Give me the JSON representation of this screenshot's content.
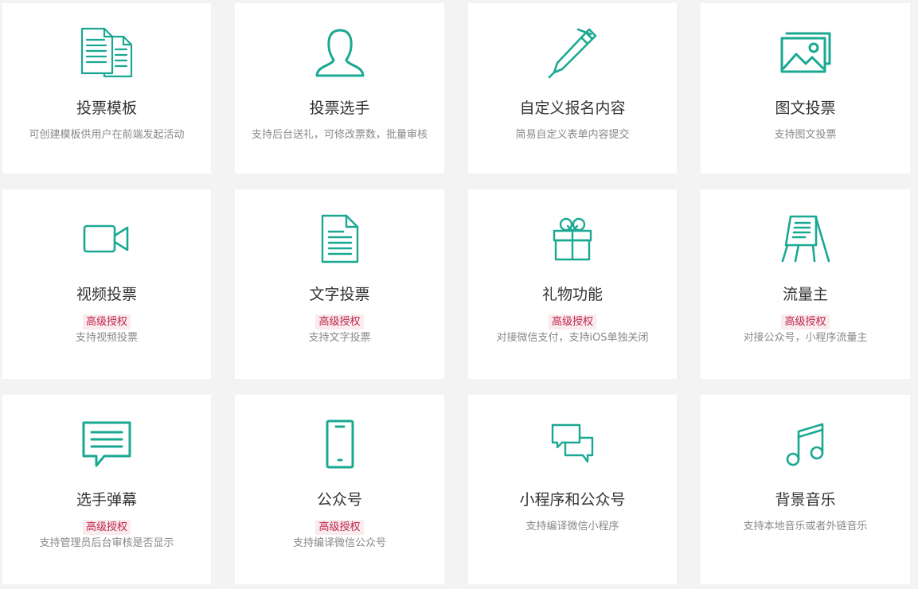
{
  "accent": "#1aa892",
  "badge_color": "#c0264c",
  "cards": [
    {
      "title": "投票模板",
      "badge": "",
      "desc": "可创建模板供用户在前端发起活动",
      "icon": "documents-icon"
    },
    {
      "title": "投票选手",
      "badge": "",
      "desc": "支持后台送礼，可修改票数，批量审核",
      "icon": "person-icon"
    },
    {
      "title": "自定义报名内容",
      "badge": "",
      "desc": "简易自定义表单内容提交",
      "icon": "pen-icon"
    },
    {
      "title": "图文投票",
      "badge": "",
      "desc": "支持图文投票",
      "icon": "image-icon"
    },
    {
      "title": "视频投票",
      "badge": "高级授权",
      "desc": "支持视频投票",
      "icon": "video-camera-icon"
    },
    {
      "title": "文字投票",
      "badge": "高级授权",
      "desc": "支持文字投票",
      "icon": "text-document-icon"
    },
    {
      "title": "礼物功能",
      "badge": "高级授权",
      "desc": "对接微信支付，支持iOS单独关闭",
      "icon": "gift-icon"
    },
    {
      "title": "流量主",
      "badge": "高级授权",
      "desc": "对接公众号，小程序流量主",
      "icon": "easel-icon"
    },
    {
      "title": "选手弹幕",
      "badge": "高级授权",
      "desc": "支持管理员后台审核是否显示",
      "icon": "message-icon"
    },
    {
      "title": "公众号",
      "badge": "高级授权",
      "desc": "支持编译微信公众号",
      "icon": "smartphone-icon"
    },
    {
      "title": "小程序和公众号",
      "badge": "",
      "desc": "支持编译微信小程序",
      "icon": "chat-bubbles-icon"
    },
    {
      "title": "背景音乐",
      "badge": "",
      "desc": "支持本地音乐或者外链音乐",
      "icon": "music-note-icon"
    }
  ]
}
